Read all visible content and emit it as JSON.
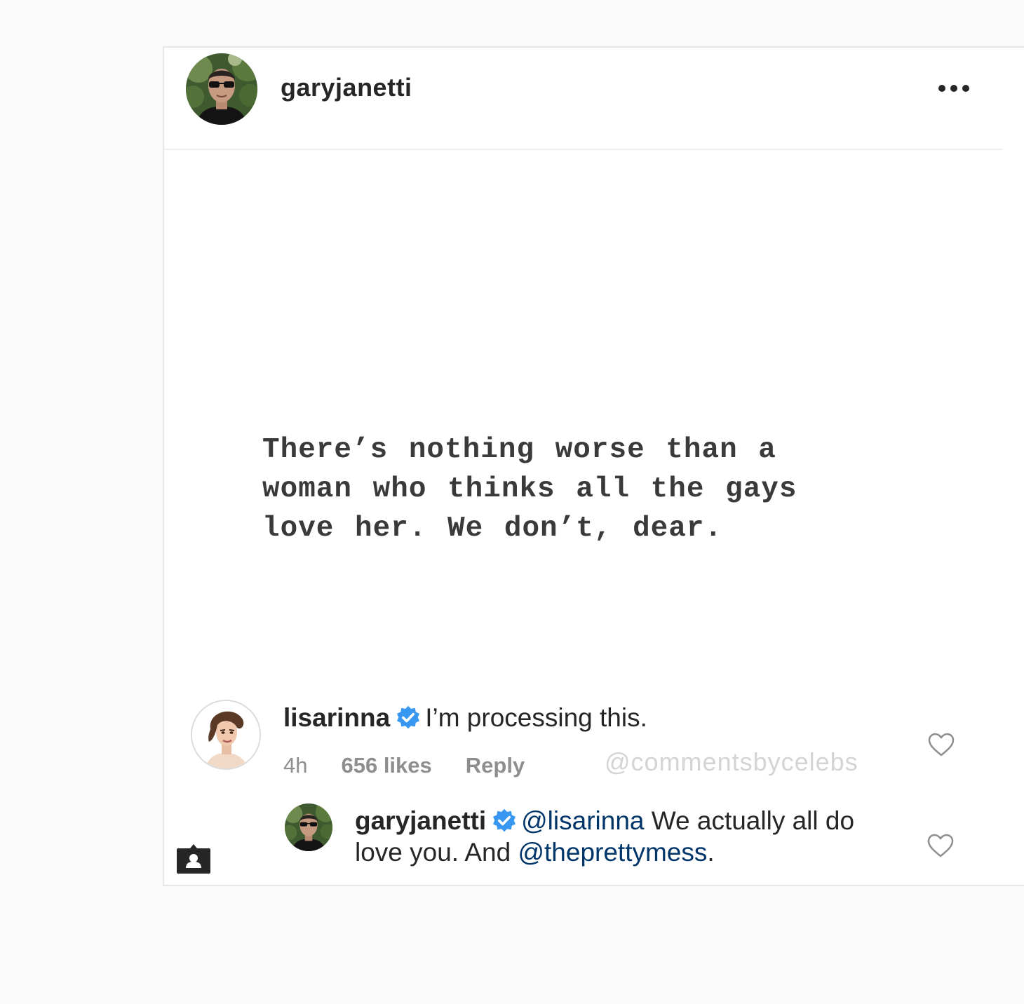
{
  "post": {
    "username": "garyjanetti",
    "more_icon": "more-horizontal-icon",
    "quote": "There’s nothing worse than a\nwoman who thinks all the gays\nlove her. We don’t, dear."
  },
  "comment": {
    "username": "lisarinna",
    "verified": true,
    "text": "I’m processing this.",
    "time": "4h",
    "likes": "656 likes",
    "reply_label": "Reply"
  },
  "watermark": "@commentsbycelebs",
  "reply": {
    "username": "garyjanetti",
    "verified": true,
    "mention_1": "@lisarinna",
    "text_1": " We actually all do love you. And ",
    "mention_2": "@theprettymess",
    "text_2": "."
  },
  "colors": {
    "verified_badge": "#3897f0",
    "mention": "#003569",
    "meta": "#8e8e8e",
    "watermark": "#d4d4d4"
  }
}
